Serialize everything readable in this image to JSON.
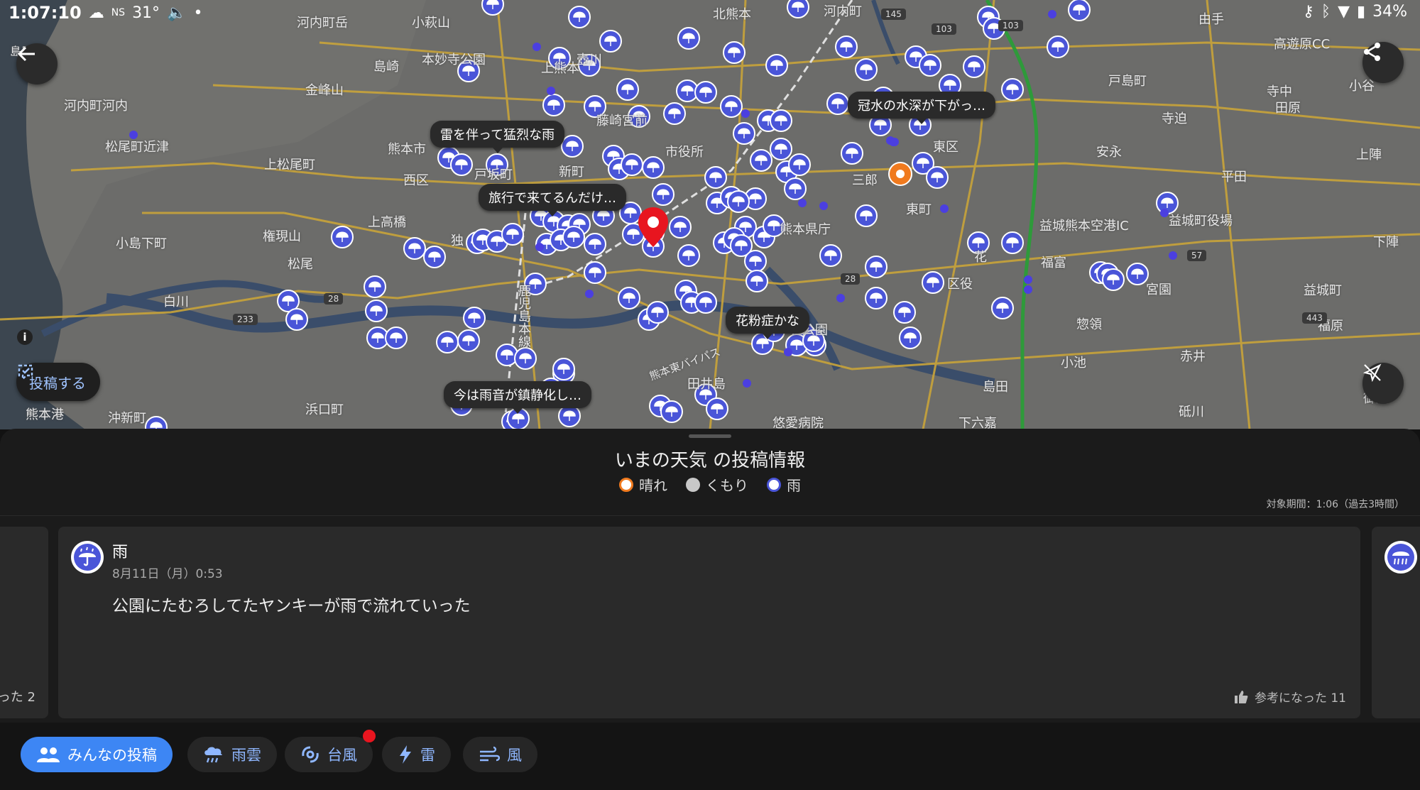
{
  "status_bar": {
    "time": "1:07:10",
    "network": "NS",
    "temperature": "31°",
    "battery": "34%"
  },
  "map": {
    "place_labels": [
      {
        "text": "河内町岳"
      },
      {
        "text": "小萩山"
      },
      {
        "text": "北熊本"
      },
      {
        "text": "河内町"
      },
      {
        "text": "島崎"
      },
      {
        "text": "本妙寺公園"
      },
      {
        "text": "上熊本"
      },
      {
        "text": "壺川"
      },
      {
        "text": "金峰山"
      },
      {
        "text": "河内町河内"
      },
      {
        "text": "藤崎宮前"
      },
      {
        "text": "熊本市"
      },
      {
        "text": "松尾町近津"
      },
      {
        "text": "上松尾町"
      },
      {
        "text": "西区"
      },
      {
        "text": "戸坂町"
      },
      {
        "text": "新町"
      },
      {
        "text": "市役所"
      },
      {
        "text": "上高橋"
      },
      {
        "text": "権現山"
      },
      {
        "text": "小島下町"
      },
      {
        "text": "松尾"
      },
      {
        "text": "独"
      },
      {
        "text": "白川"
      },
      {
        "text": "熊本港"
      },
      {
        "text": "沖新町"
      },
      {
        "text": "浜口町"
      },
      {
        "text": "鹿児島本線"
      },
      {
        "text": "熊本東バイパス"
      },
      {
        "text": "田井島"
      },
      {
        "text": "悠愛病院"
      },
      {
        "text": "熊本県庁"
      },
      {
        "text": "三郎"
      },
      {
        "text": "東町"
      },
      {
        "text": "東区"
      },
      {
        "text": "花"
      },
      {
        "text": "区役"
      },
      {
        "text": "公園"
      },
      {
        "text": "益城熊本空港IC"
      },
      {
        "text": "益城町役場"
      },
      {
        "text": "福富"
      },
      {
        "text": "宮園"
      },
      {
        "text": "惣領"
      },
      {
        "text": "小池"
      },
      {
        "text": "島田"
      },
      {
        "text": "下六嘉"
      },
      {
        "text": "赤井"
      },
      {
        "text": "砥川"
      },
      {
        "text": "御船"
      },
      {
        "text": "益城町"
      },
      {
        "text": "福原"
      },
      {
        "text": "由手"
      },
      {
        "text": "高遊原CC"
      },
      {
        "text": "戸島町"
      },
      {
        "text": "寺中"
      },
      {
        "text": "小谷"
      },
      {
        "text": "寺迫"
      },
      {
        "text": "田原"
      },
      {
        "text": "安永"
      },
      {
        "text": "上陣"
      },
      {
        "text": "平田"
      },
      {
        "text": "下陣"
      },
      {
        "text": "島原湾"
      }
    ],
    "road_numbers": [
      "145",
      "103",
      "103",
      "28",
      "233",
      "28",
      "57",
      "443"
    ],
    "callouts": [
      {
        "text": "雷を伴って猛烈な雨"
      },
      {
        "text": "旅行で来てるんだけ…"
      },
      {
        "text": "冠水の水深が下がっ…"
      },
      {
        "text": "花粉症かな"
      },
      {
        "text": "今は雨音が鎮静化し…"
      }
    ],
    "back_icon": "arrow-left-icon",
    "share_icon": "share-icon",
    "location_icon": "location-off-icon",
    "post_button_label": "投稿する",
    "info_label": "i"
  },
  "panel": {
    "title": "いまの天気 の投稿情報",
    "legend": [
      {
        "label": "晴れ",
        "color": "#f07a1e"
      },
      {
        "label": "くもり",
        "color": "#c8c8c8"
      },
      {
        "label": "雨",
        "color": "#4a55d8"
      }
    ],
    "period": "対象期間：1:06（過去3時間）",
    "left_card_fragment": "った 2",
    "main_card": {
      "weather": "雨",
      "date": "8月11日（月）0:53",
      "body": "公園にたむろしてたヤンキーが雨で流れていった",
      "helpful_label": "参考になった 11"
    }
  },
  "tabs": [
    {
      "label": "みんなの投稿",
      "icon": "people-icon",
      "active": true
    },
    {
      "label": "雨雲",
      "icon": "rain-cloud-icon",
      "active": false
    },
    {
      "label": "台風",
      "icon": "typhoon-icon",
      "active": false
    },
    {
      "label": "雷",
      "icon": "lightning-icon",
      "active": false
    },
    {
      "label": "風",
      "icon": "wind-icon",
      "active": false
    }
  ],
  "colors": {
    "accent": "#3d86f4",
    "rain_marker": "#4a55d8",
    "sunny_marker": "#f07a1e",
    "location_pin": "#e8151f",
    "notification_badge": "#e8151f"
  }
}
